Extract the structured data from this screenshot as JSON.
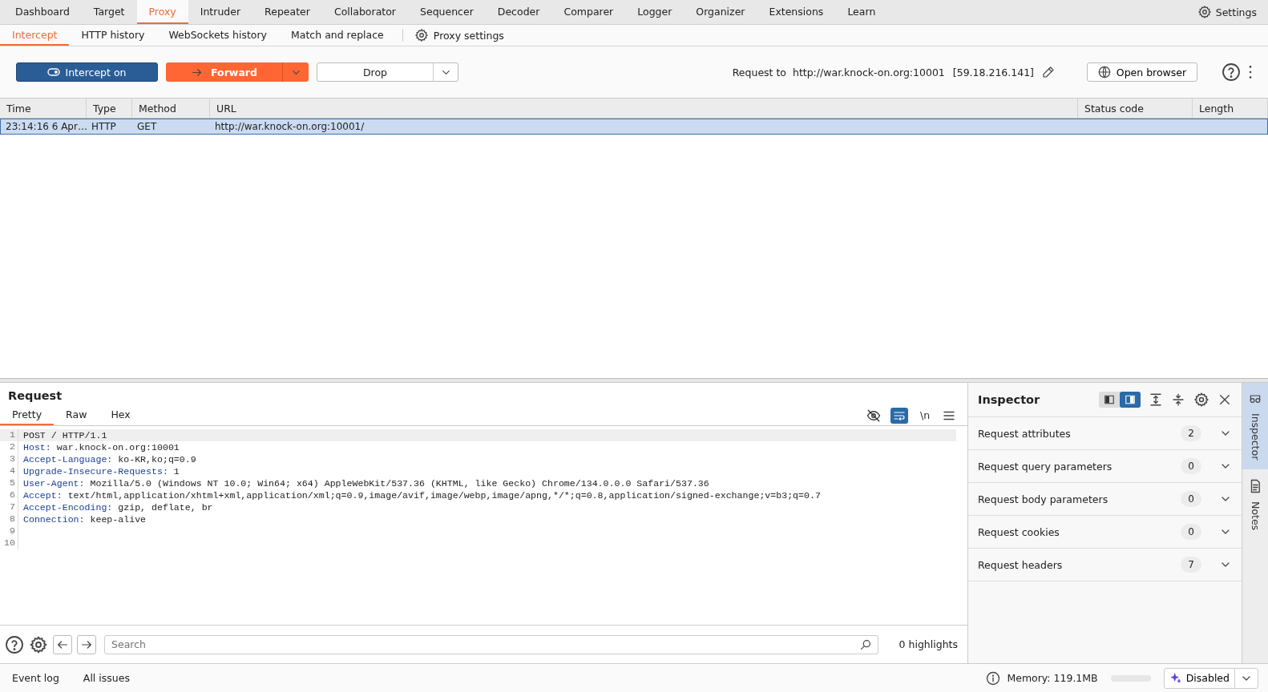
{
  "main_tabs": [
    {
      "label": "Dashboard",
      "selected": false
    },
    {
      "label": "Target",
      "selected": false
    },
    {
      "label": "Proxy",
      "selected": true
    },
    {
      "label": "Intruder",
      "selected": false
    },
    {
      "label": "Repeater",
      "selected": false
    },
    {
      "label": "Collaborator",
      "selected": false
    },
    {
      "label": "Sequencer",
      "selected": false
    },
    {
      "label": "Decoder",
      "selected": false
    },
    {
      "label": "Comparer",
      "selected": false
    },
    {
      "label": "Logger",
      "selected": false
    },
    {
      "label": "Organizer",
      "selected": false
    },
    {
      "label": "Extensions",
      "selected": false
    },
    {
      "label": "Learn",
      "selected": false
    }
  ],
  "settings_label": "Settings",
  "proxy_tabs": [
    {
      "label": "Intercept",
      "selected": true
    },
    {
      "label": "HTTP history",
      "selected": false
    },
    {
      "label": "WebSockets history",
      "selected": false
    },
    {
      "label": "Match and replace",
      "selected": false
    }
  ],
  "proxy_settings_label": "Proxy settings",
  "toolbar": {
    "intercept": {
      "label": "Intercept on",
      "on": true
    },
    "forward": "Forward",
    "drop": "Drop",
    "request_to": "Request to  http://war.knock-on.org:10001",
    "ip": "[59.18.216.141]",
    "open_browser": "Open browser"
  },
  "table": {
    "columns": [
      "Time",
      "Type",
      "Method",
      "URL",
      "Status code",
      "Length"
    ],
    "rows": [
      {
        "cells": [
          "23:14:16 6 Apr…",
          "HTTP",
          "GET",
          "http://war.knock-on.org:10001/",
          "",
          ""
        ],
        "selected": true
      }
    ]
  },
  "request": {
    "title": "Request",
    "tabs": [
      {
        "label": "Pretty",
        "selected": true
      },
      {
        "label": "Raw",
        "selected": false
      },
      {
        "label": "Hex",
        "selected": false
      }
    ],
    "editor_tools": {
      "hide_nonprintable": {
        "selected": false
      },
      "wrap": {
        "selected": true
      },
      "newline_label": "\\n"
    },
    "lines": [
      {
        "number": "1",
        "kind": "request-line",
        "text": "POST / HTTP/1.1"
      },
      {
        "number": "2",
        "kind": "header",
        "name": "Host:",
        "value": " war.knock-on.org:10001"
      },
      {
        "number": "3",
        "kind": "header",
        "name": "Accept-Language:",
        "value": " ko-KR,ko;q=0.9"
      },
      {
        "number": "4",
        "kind": "header",
        "name": "Upgrade-Insecure-Requests:",
        "value": " 1"
      },
      {
        "number": "5",
        "kind": "header",
        "name": "User-Agent:",
        "value": " Mozilla/5.0 (Windows NT 10.0; Win64; x64) AppleWebKit/537.36 (KHTML, like Gecko) Chrome/134.0.0.0 Safari/537.36"
      },
      {
        "number": "6",
        "kind": "header",
        "name": "Accept:",
        "value": " text/html,application/xhtml+xml,application/xml;q=0.9,image/avif,image/webp,image/apng,*/*;q=0.8,application/signed-exchange;v=b3;q=0.7"
      },
      {
        "number": "7",
        "kind": "header",
        "name": "Accept-Encoding:",
        "value": " gzip, deflate, br"
      },
      {
        "number": "8",
        "kind": "header",
        "name": "Connection:",
        "value": " keep-alive"
      },
      {
        "number": "9",
        "kind": "blank"
      },
      {
        "number": "10",
        "kind": "blank"
      }
    ],
    "search": {
      "placeholder": "Search"
    },
    "highlights": "0 highlights"
  },
  "inspector": {
    "title": "Inspector",
    "layout": [
      {
        "selected": false
      },
      {
        "selected": true
      }
    ],
    "sections": [
      {
        "label": "Request attributes",
        "count": "2"
      },
      {
        "label": "Request query parameters",
        "count": "0"
      },
      {
        "label": "Request body parameters",
        "count": "0"
      },
      {
        "label": "Request cookies",
        "count": "0"
      },
      {
        "label": "Request headers",
        "count": "7"
      }
    ]
  },
  "side_tabs": [
    {
      "label": "Inspector",
      "kind": "inspector",
      "selected": true
    },
    {
      "label": "Notes",
      "kind": "notes",
      "selected": false
    }
  ],
  "status_bar": {
    "event_log": "Event log",
    "all_issues": "All issues",
    "memory": "Memory: 119.1MB",
    "ai": "Disabled"
  }
}
